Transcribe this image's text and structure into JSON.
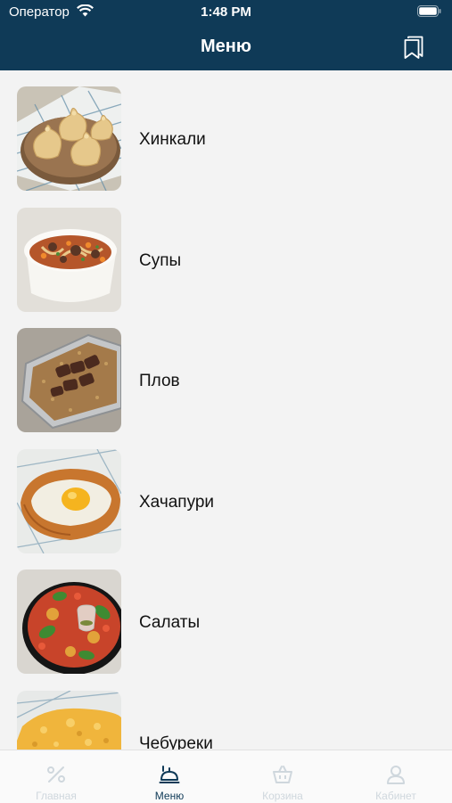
{
  "status_bar": {
    "carrier": "Оператор",
    "time": "1:48 PM"
  },
  "header": {
    "title": "Меню"
  },
  "menu": {
    "items": [
      {
        "label": "Хинкали",
        "thumb_icon": "khinkali-photo"
      },
      {
        "label": "Супы",
        "thumb_icon": "soup-photo"
      },
      {
        "label": "Плов",
        "thumb_icon": "plov-photo"
      },
      {
        "label": "Хачапури",
        "thumb_icon": "khachapuri-photo"
      },
      {
        "label": "Салаты",
        "thumb_icon": "salad-photo"
      },
      {
        "label": "Чебуреки",
        "thumb_icon": "chebureki-photo"
      }
    ]
  },
  "tabbar": {
    "tabs": [
      {
        "label": "Главная",
        "icon": "promo-icon",
        "active": false
      },
      {
        "label": "Меню",
        "icon": "menu-icon",
        "active": true
      },
      {
        "label": "Корзина",
        "icon": "basket-icon",
        "active": false
      },
      {
        "label": "Кабинет",
        "icon": "profile-icon",
        "active": false
      }
    ]
  },
  "colors": {
    "header_bg": "#0f3a57",
    "page_bg": "#f3f3f3",
    "active_tab": "#0f3a57",
    "inactive_tab": "#cfd7dd"
  }
}
